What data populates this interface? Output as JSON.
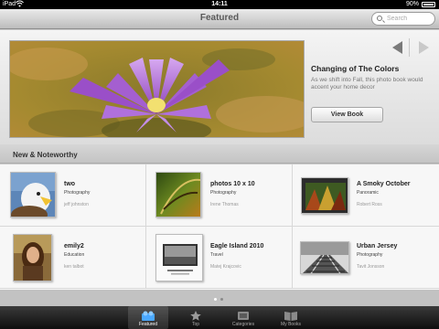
{
  "status_bar": {
    "carrier": "iPad",
    "time": "14:11",
    "battery": "90%"
  },
  "nav": {
    "title": "Featured",
    "search_placeholder": "Search"
  },
  "feature": {
    "title": "Changing of The Colors",
    "description": "As we shift into Fall, this photo book would  accent your home decor",
    "button": "View Book"
  },
  "section": {
    "title": "New & Noteworthy"
  },
  "books": [
    {
      "title": "two",
      "category": "Photography",
      "author": "jeff johnston",
      "cover": "eagle"
    },
    {
      "title": "photos 10 x 10",
      "category": "Photography",
      "author": "Irene Thomas",
      "cover": "leaf"
    },
    {
      "title": "A Smoky October",
      "category": "Panoramic",
      "author": "Robert Ross",
      "cover": "forest"
    },
    {
      "title": "emily2",
      "category": "Education",
      "author": "ken talbot",
      "cover": "portrait"
    },
    {
      "title": "Eagle Island 2010",
      "category": "Travel",
      "author": "Matej Krajcovic",
      "cover": "island"
    },
    {
      "title": "Urban Jersey",
      "category": "Photography",
      "author": "Tavit Jonsson",
      "cover": "tracks"
    }
  ],
  "pager": {
    "pages": 2,
    "current": 1
  },
  "tabs": [
    {
      "label": "Featured",
      "icon": "featured-icon",
      "active": true
    },
    {
      "label": "Top",
      "icon": "star-icon",
      "active": false
    },
    {
      "label": "Categories",
      "icon": "categories-icon",
      "active": false
    },
    {
      "label": "My Books",
      "icon": "book-icon",
      "active": false
    }
  ],
  "colors": {
    "tab_active_label": "#ffffff",
    "tab_label": "#aaaaaa"
  }
}
